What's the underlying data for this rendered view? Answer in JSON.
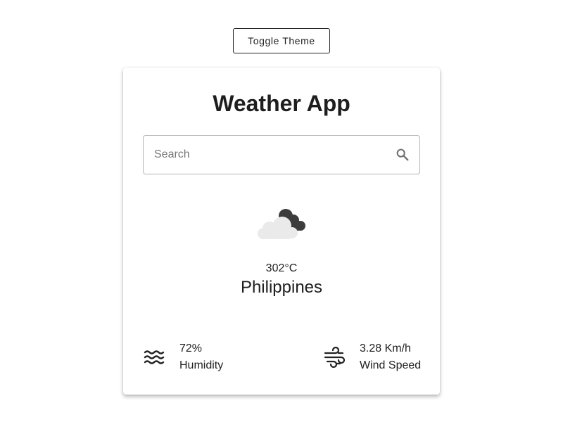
{
  "toggle_theme_label": "Toggle Theme",
  "app_title": "Weather App",
  "search": {
    "placeholder": "Search",
    "value": ""
  },
  "weather": {
    "icon": "cloudy-night-icon",
    "temperature": "302°C",
    "location": "Philippines"
  },
  "humidity": {
    "value": "72%",
    "label": "Humidity",
    "icon": "humidity-waves-icon"
  },
  "wind": {
    "value": "3.28 Km/h",
    "label": "Wind Speed",
    "icon": "wind-icon"
  },
  "colors": {
    "text": "#1e1e1e",
    "border": "#b5b5b5",
    "cloud_light": "#eaeaea",
    "cloud_dark": "#3c3c3c",
    "background": "#ffffff"
  }
}
